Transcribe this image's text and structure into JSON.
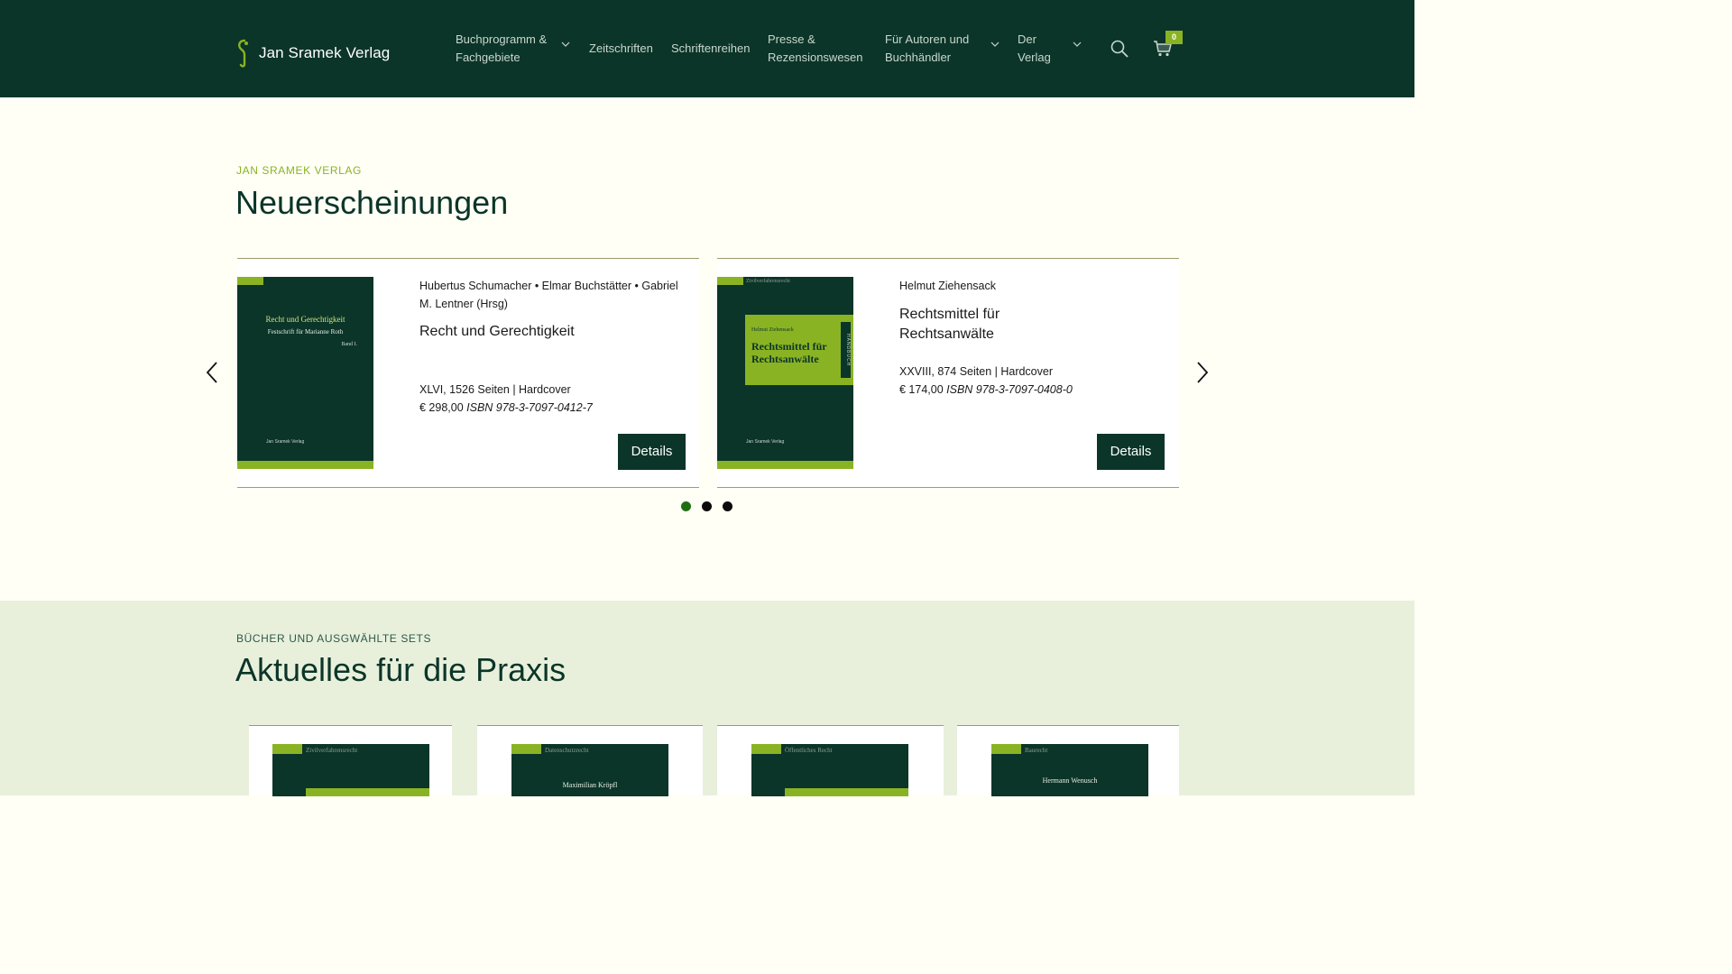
{
  "header": {
    "logo_text": "Jan Sramek Verlag",
    "nav": [
      {
        "line1": "Buchprogramm &",
        "line2": "Fachgebiete",
        "dropdown": true
      },
      {
        "line1": "Zeitschriften",
        "line2": "",
        "dropdown": false
      },
      {
        "line1": "Schriftenreihen",
        "line2": "",
        "dropdown": false
      },
      {
        "line1": "Presse &",
        "line2": "Rezensionswesen",
        "dropdown": false
      },
      {
        "line1": "Für Autoren und",
        "line2": "Buchhändler",
        "dropdown": true
      },
      {
        "line1": "Der",
        "line2": "Verlag",
        "dropdown": true
      }
    ],
    "cart_count": "0"
  },
  "new_releases": {
    "eyebrow": "Jan Sramek Verlag",
    "title": "Neuerscheinungen",
    "books": [
      {
        "authors": "Hubertus Schumacher • Elmar Buchstätter • Gabriel M. Lentner (Hrsg)",
        "title": "Recht und Gerechtigkeit",
        "pages": "XLVI, 1526 Seiten | Hardcover",
        "price": "€ 298,00",
        "isbn": "ISBN 978-3-7097-0412-7",
        "button": "Details",
        "cover": {
          "title": "Recht und Gerechtigkeit",
          "subtitle": "Festschrift für Marianne Roth",
          "volume": "Band I.",
          "publisher": "Jan Sramek Verlag"
        }
      },
      {
        "authors": "Helmut Ziehensack",
        "title": "Rechtsmittel für Rechtsanwälte",
        "pages": "XXVIII, 874 Seiten | Hardcover",
        "price": "€ 174,00",
        "isbn": "ISBN 978-3-7097-0408-0",
        "button": "Details",
        "cover": {
          "series": "Zivilverfahrensrecht",
          "author": "Helmut Ziehensack",
          "title_line1": "Rechtsmittel für",
          "title_line2": "Rechtsanwälte",
          "spine": "HANDBUCH",
          "publisher": "Jan Sramek Verlag"
        }
      }
    ],
    "pagination": {
      "count": 3,
      "active": 0
    }
  },
  "praxis": {
    "eyebrow": "Bücher und ausgwählte Sets",
    "title": "Aktuelles für die Praxis",
    "covers": [
      {
        "series": "Zivilverfahrensrecht",
        "name": ""
      },
      {
        "series": "Datenschutzrecht",
        "name": "Maximilian Kröpfl"
      },
      {
        "series": "Öffentliches Recht",
        "name": ""
      },
      {
        "series": "Baurecht",
        "name": "Hermann Wenusch"
      }
    ]
  },
  "colors": {
    "header_bg": "#0b3528",
    "accent_green": "#8ab324",
    "page_bg": "#fffff6",
    "praxis_bg": "#e8f0dc",
    "active_dot": "#1f6f12"
  },
  "icons": [
    "logo-mark-icon",
    "chevron-down-icon",
    "search-icon",
    "cart-icon",
    "chevron-left-icon",
    "chevron-right-icon"
  ]
}
